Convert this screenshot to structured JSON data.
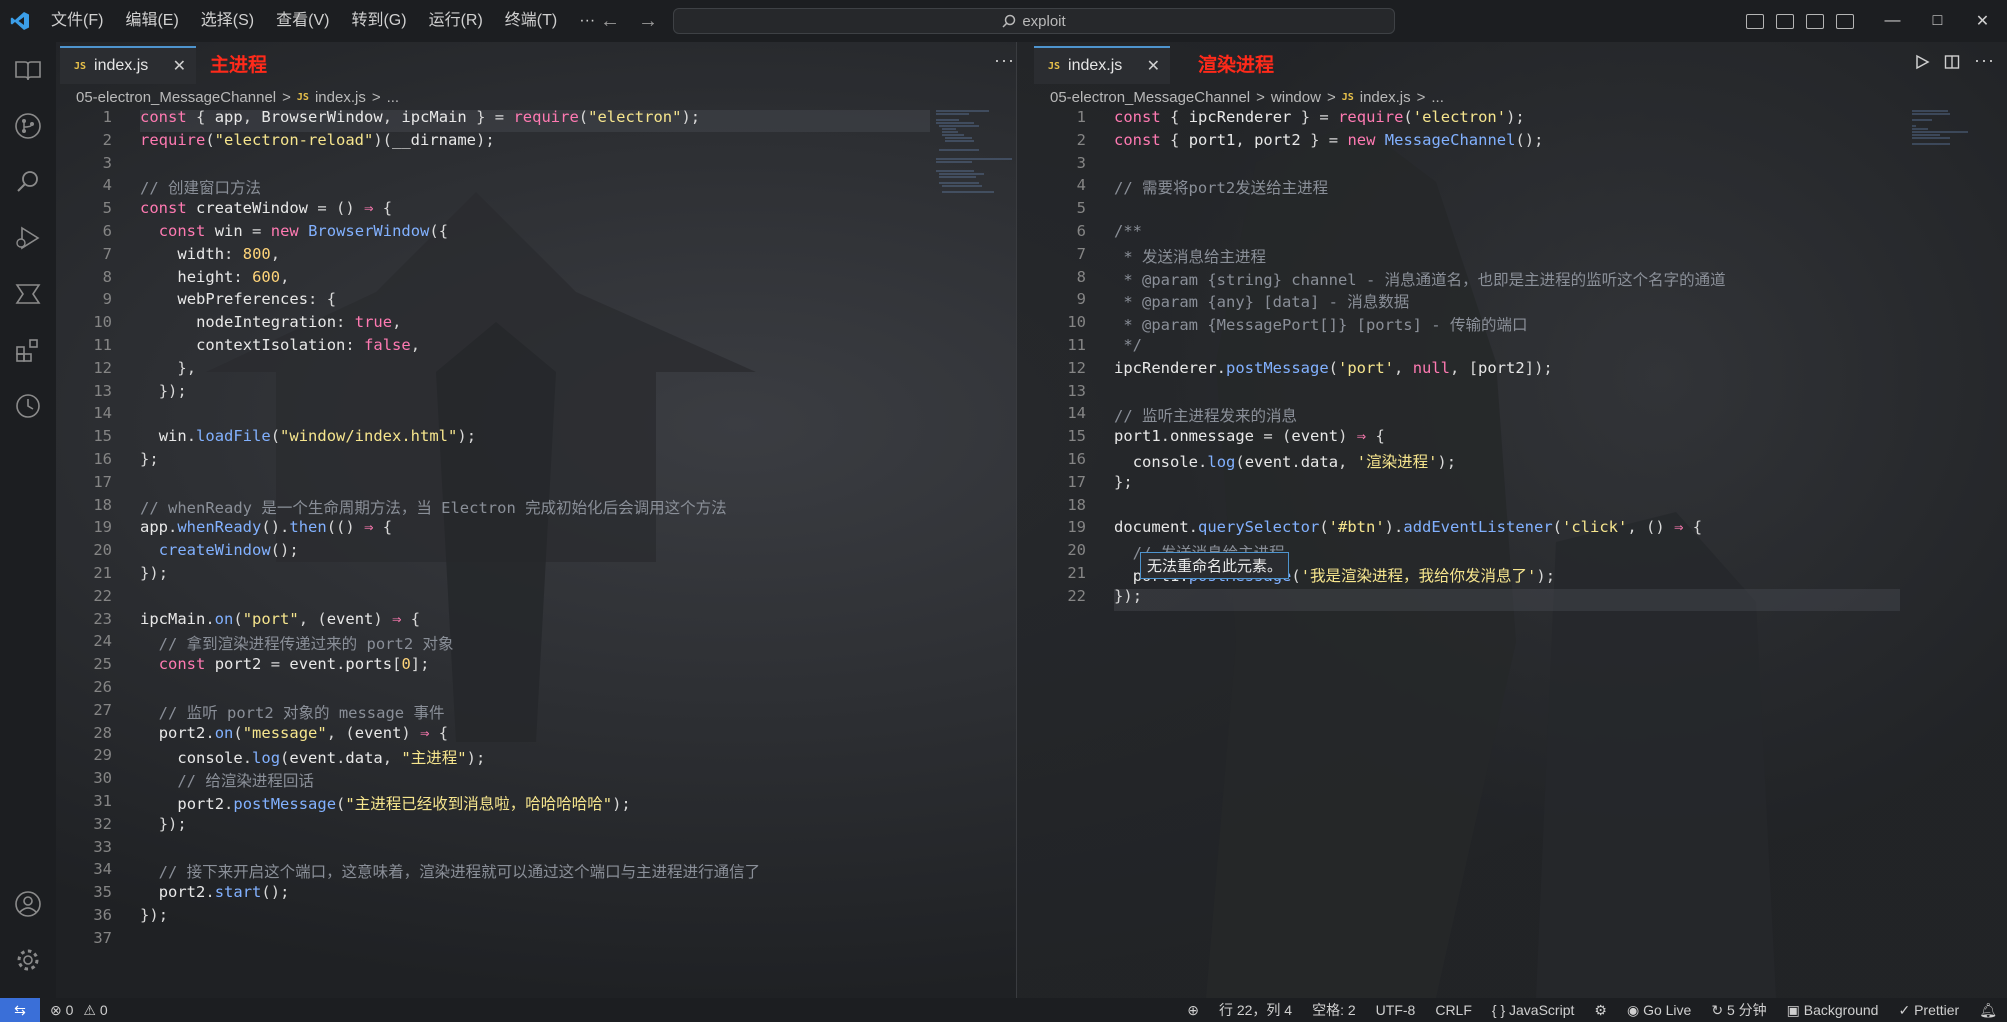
{
  "titlebar": {
    "menu": [
      "文件(F)",
      "编辑(E)",
      "选择(S)",
      "查看(V)",
      "转到(G)",
      "运行(R)",
      "终端(T)",
      "···"
    ],
    "search_text": "exploit",
    "controls": {
      "minimize": "—",
      "maximize": "□",
      "close": "✕"
    }
  },
  "left_editor": {
    "tab_name": "index.js",
    "tab_close": "✕",
    "process_label": "主进程",
    "more": "···",
    "breadcrumb": [
      "05-electron_MessageChannel",
      ">",
      "index.js",
      ">",
      "..."
    ],
    "lines": [
      {
        "n": "1",
        "t": "const { app, BrowserWindow, ipcMain } = require(\"electron\");"
      },
      {
        "n": "2",
        "t": "require(\"electron-reload\")(__dirname);"
      },
      {
        "n": "3",
        "t": ""
      },
      {
        "n": "4",
        "t": "// 创建窗口方法"
      },
      {
        "n": "5",
        "t": "const createWindow = () ⇒ {"
      },
      {
        "n": "6",
        "t": "  const win = new BrowserWindow({"
      },
      {
        "n": "7",
        "t": "    width: 800,"
      },
      {
        "n": "8",
        "t": "    height: 600,"
      },
      {
        "n": "9",
        "t": "    webPreferences: {"
      },
      {
        "n": "10",
        "t": "      nodeIntegration: true,"
      },
      {
        "n": "11",
        "t": "      contextIsolation: false,"
      },
      {
        "n": "12",
        "t": "    },"
      },
      {
        "n": "13",
        "t": "  });"
      },
      {
        "n": "14",
        "t": ""
      },
      {
        "n": "15",
        "t": "  win.loadFile(\"window/index.html\");"
      },
      {
        "n": "16",
        "t": "};"
      },
      {
        "n": "17",
        "t": ""
      },
      {
        "n": "18",
        "t": "// whenReady 是一个生命周期方法，当 Electron 完成初始化后会调用这个方法"
      },
      {
        "n": "19",
        "t": "app.whenReady().then(() ⇒ {"
      },
      {
        "n": "20",
        "t": "  createWindow();"
      },
      {
        "n": "21",
        "t": "});"
      },
      {
        "n": "22",
        "t": ""
      },
      {
        "n": "23",
        "t": "ipcMain.on(\"port\", (event) ⇒ {"
      },
      {
        "n": "24",
        "t": "  // 拿到渲染进程传递过来的 port2 对象"
      },
      {
        "n": "25",
        "t": "  const port2 = event.ports[0];"
      },
      {
        "n": "26",
        "t": ""
      },
      {
        "n": "27",
        "t": "  // 监听 port2 对象的 message 事件"
      },
      {
        "n": "28",
        "t": "  port2.on(\"message\", (event) ⇒ {"
      },
      {
        "n": "29",
        "t": "    console.log(event.data, \"主进程\");"
      },
      {
        "n": "30",
        "t": "    // 给渲染进程回话"
      },
      {
        "n": "31",
        "t": "    port2.postMessage(\"主进程已经收到消息啦，哈哈哈哈哈\");"
      },
      {
        "n": "32",
        "t": "  });"
      },
      {
        "n": "33",
        "t": ""
      },
      {
        "n": "34",
        "t": "  // 接下来开启这个端口，这意味着，渲染进程就可以通过这个端口与主进程进行通信了"
      },
      {
        "n": "35",
        "t": "  port2.start();"
      },
      {
        "n": "36",
        "t": "});"
      },
      {
        "n": "37",
        "t": ""
      }
    ]
  },
  "right_editor": {
    "tab_name": "index.js",
    "tab_close": "✕",
    "process_label": "渲染进程",
    "breadcrumb": [
      "05-electron_MessageChannel",
      ">",
      "window",
      ">",
      "index.js",
      ">",
      "..."
    ],
    "tooltip": "无法重命名此元素。",
    "lines": [
      {
        "n": "1",
        "t": "const { ipcRenderer } = require('electron');"
      },
      {
        "n": "2",
        "t": "const { port1, port2 } = new MessageChannel();"
      },
      {
        "n": "3",
        "t": ""
      },
      {
        "n": "4",
        "t": "// 需要将port2发送给主进程"
      },
      {
        "n": "5",
        "t": ""
      },
      {
        "n": "6",
        "t": "/**"
      },
      {
        "n": "7",
        "t": " * 发送消息给主进程"
      },
      {
        "n": "8",
        "t": " * @param {string} channel - 消息通道名，也即是主进程的监听这个名字的通道"
      },
      {
        "n": "9",
        "t": " * @param {any} [data] - 消息数据"
      },
      {
        "n": "10",
        "t": " * @param {MessagePort[]} [ports] - 传输的端口"
      },
      {
        "n": "11",
        "t": " */"
      },
      {
        "n": "12",
        "t": "ipcRenderer.postMessage('port', null, [port2]);"
      },
      {
        "n": "13",
        "t": ""
      },
      {
        "n": "14",
        "t": "// 监听主进程发来的消息"
      },
      {
        "n": "15",
        "t": "port1.onmessage = (event) ⇒ {"
      },
      {
        "n": "16",
        "t": "  console.log(event.data, '渲染进程');"
      },
      {
        "n": "17",
        "t": "};"
      },
      {
        "n": "18",
        "t": ""
      },
      {
        "n": "19",
        "t": "document.querySelector('#btn').addEventListener('click', () ⇒ {"
      },
      {
        "n": "20",
        "t": "  // 发送消息给主进程"
      },
      {
        "n": "21",
        "t": "  port1.postMessage('我是渲染进程，我给你发消息了');"
      },
      {
        "n": "22",
        "t": "});"
      }
    ]
  },
  "statusbar": {
    "errors": "⊗ 0",
    "warnings": "⚠ 0",
    "position": "行 22，列 4",
    "spaces": "空格: 2",
    "encoding": "UTF-8",
    "eol": "CRLF",
    "language": "{ } JavaScript",
    "golive": "Go Live",
    "timer": "5 分钟",
    "background": "Background",
    "prettier": "✓ Prettier"
  },
  "colors": {
    "accent": "#4e94ce",
    "process_label": "#ff2a1a",
    "remote": "#3a6fd8"
  }
}
